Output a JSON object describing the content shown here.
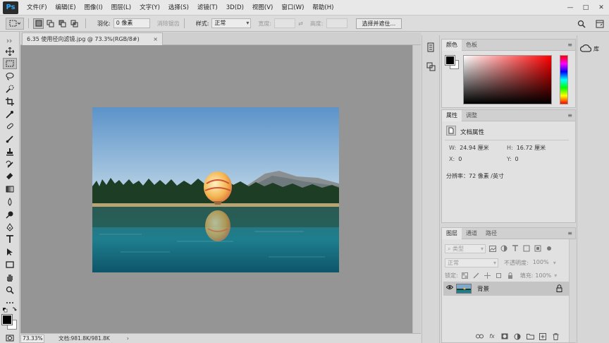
{
  "app": {
    "logo": "Ps",
    "menu": [
      "文件(F)",
      "编辑(E)",
      "图像(I)",
      "图层(L)",
      "文字(Y)",
      "选择(S)",
      "滤镜(T)",
      "3D(D)",
      "视图(V)",
      "窗口(W)",
      "帮助(H)"
    ],
    "window_controls": [
      "—",
      "□",
      "✕"
    ]
  },
  "options_bar": {
    "feather_label": "羽化:",
    "feather_value": "0 像素",
    "antialias_label": "消除锯齿",
    "style_label": "样式:",
    "style_value": "正常",
    "width_label": "宽度:",
    "height_label": "高度:",
    "select_mask_button": "选择并遮住..."
  },
  "document": {
    "tab_title": "6.35 使用径向滤镜.jpg @ 73.3%(RGB/8#)",
    "close": "×",
    "zoom": "73.33%",
    "doc_info": "文档:981.8K/981.8K",
    "status_arrow": "›"
  },
  "color_panel": {
    "tabs": [
      "颜色",
      "色板"
    ],
    "active_tab": 0,
    "foreground": "#000000",
    "background": "#ffffff"
  },
  "properties_panel": {
    "tabs": [
      "属性",
      "调整"
    ],
    "active_tab": 0,
    "section_title": "文档属性",
    "w_label": "W:",
    "w_value": "24.94 厘米",
    "h_label": "H:",
    "h_value": "16.72 厘米",
    "x_label": "X:",
    "x_value": "0",
    "y_label": "Y:",
    "y_value": "0",
    "resolution": "分辨率：72 像素 /英寸"
  },
  "layers_panel": {
    "tabs": [
      "图层",
      "通道",
      "路径"
    ],
    "active_tab": 0,
    "filter_placeholder": "类型",
    "blend_mode": "正常",
    "opacity_label": "不透明度:",
    "opacity_value": "100%",
    "lock_label": "锁定:",
    "fill_label": "填充:",
    "fill_value": "100%",
    "layers": [
      {
        "name": "背景",
        "visible": true,
        "locked": true
      }
    ]
  },
  "right_strip": {
    "library_label": "库"
  },
  "colors": {
    "canvas_bg": "#959595",
    "panel_bg": "#e1e1e1",
    "ui_bg": "#dcdcdc",
    "ps_blue": "#31a8ff"
  }
}
